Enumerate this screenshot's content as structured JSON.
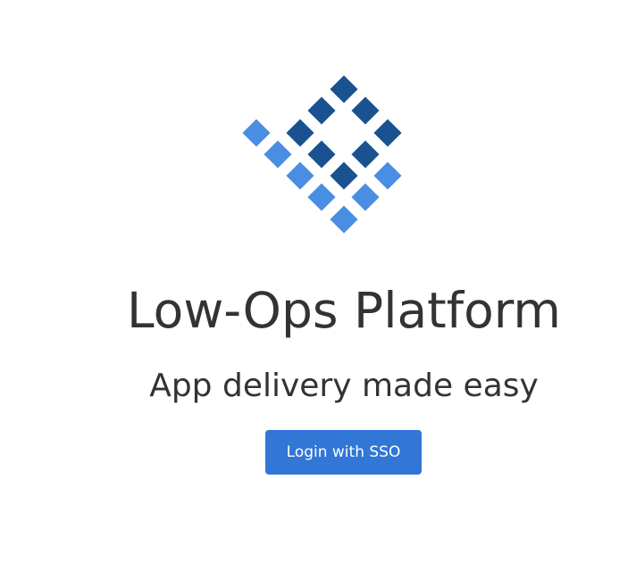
{
  "hero": {
    "logo_icon": "diamond-grid-checkmark-icon",
    "title": "Low-Ops Platform",
    "subtitle": "App delivery made easy"
  },
  "login": {
    "label": "Login with SSO"
  },
  "colors": {
    "logo_dark": "#1a5291",
    "logo_light": "#4a8ee3",
    "button_bg": "#3276d6",
    "button_text": "#ffffff",
    "text": "#333333"
  }
}
